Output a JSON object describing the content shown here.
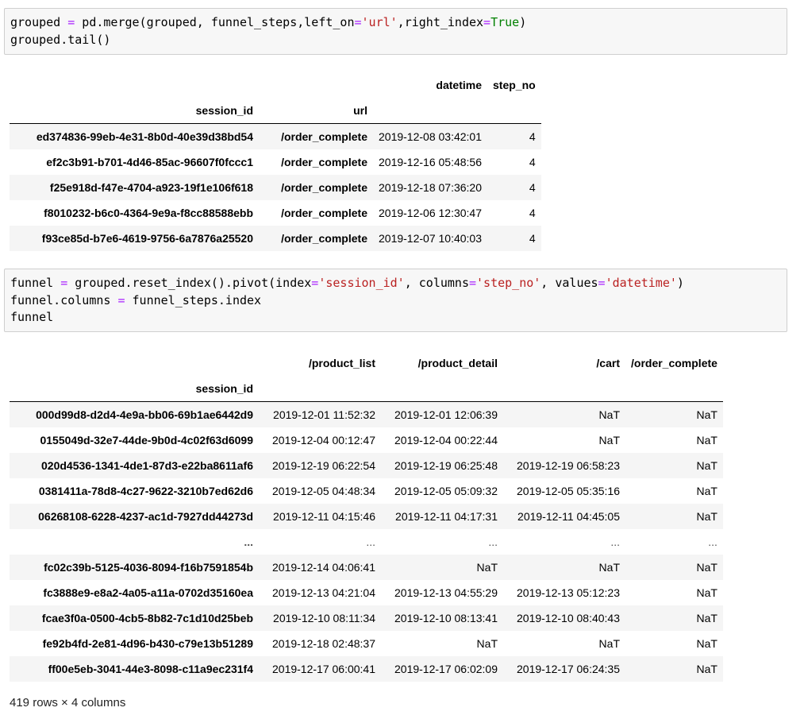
{
  "cell1": {
    "code": {
      "l1_a": "grouped ",
      "l1_b": "=",
      "l1_c": " pd.merge(grouped, funnel_steps,left_on",
      "l1_d": "=",
      "l1_e": "'url'",
      "l1_f": ",right_index",
      "l1_g": "=",
      "l1_h": "True",
      "l1_i": ")",
      "l2": "grouped.tail()"
    }
  },
  "table1": {
    "col_header_datetime": "datetime",
    "col_header_step_no": "step_no",
    "index_name": "session_id",
    "index_name2": "url",
    "rows": [
      {
        "session_id": "ed374836-99eb-4e31-8b0d-40e39d38bd54",
        "url": "/order_complete",
        "datetime": "2019-12-08 03:42:01",
        "step_no": "4"
      },
      {
        "session_id": "ef2c3b91-b701-4d46-85ac-96607f0fccc1",
        "url": "/order_complete",
        "datetime": "2019-12-16 05:48:56",
        "step_no": "4"
      },
      {
        "session_id": "f25e918d-f47e-4704-a923-19f1e106f618",
        "url": "/order_complete",
        "datetime": "2019-12-18 07:36:20",
        "step_no": "4"
      },
      {
        "session_id": "f8010232-b6c0-4364-9e9a-f8cc88588ebb",
        "url": "/order_complete",
        "datetime": "2019-12-06 12:30:47",
        "step_no": "4"
      },
      {
        "session_id": "f93ce85d-b7e6-4619-9756-6a7876a25520",
        "url": "/order_complete",
        "datetime": "2019-12-07 10:40:03",
        "step_no": "4"
      }
    ]
  },
  "cell2": {
    "code": {
      "l1_a": "funnel ",
      "l1_b": "=",
      "l1_c": " grouped.reset_index().pivot(index",
      "l1_d": "=",
      "l1_e": "'session_id'",
      "l1_f": ", columns",
      "l1_g": "=",
      "l1_h": "'step_no'",
      "l1_i": ", values",
      "l1_j": "=",
      "l1_k": "'datetime'",
      "l1_l": ")",
      "l2_a": "funnel.columns ",
      "l2_b": "=",
      "l2_c": " funnel_steps.index",
      "l3": "funnel"
    }
  },
  "table2": {
    "columns": [
      "/product_list",
      "/product_detail",
      "/cart",
      "/order_complete"
    ],
    "index_name": "session_id",
    "rows": [
      [
        "000d99d8-d2d4-4e9a-bb06-69b1ae6442d9",
        "2019-12-01 11:52:32",
        "2019-12-01 12:06:39",
        "NaT",
        "NaT"
      ],
      [
        "0155049d-32e7-44de-9b0d-4c02f63d6099",
        "2019-12-04 00:12:47",
        "2019-12-04 00:22:44",
        "NaT",
        "NaT"
      ],
      [
        "020d4536-1341-4de1-87d3-e22ba8611af6",
        "2019-12-19 06:22:54",
        "2019-12-19 06:25:48",
        "2019-12-19 06:58:23",
        "NaT"
      ],
      [
        "0381411a-78d8-4c27-9622-3210b7ed62d6",
        "2019-12-05 04:48:34",
        "2019-12-05 05:09:32",
        "2019-12-05 05:35:16",
        "NaT"
      ],
      [
        "06268108-6228-4237-ac1d-7927dd44273d",
        "2019-12-11 04:15:46",
        "2019-12-11 04:17:31",
        "2019-12-11 04:45:05",
        "NaT"
      ],
      [
        "...",
        "...",
        "...",
        "...",
        "..."
      ],
      [
        "fc02c39b-5125-4036-8094-f16b7591854b",
        "2019-12-14 04:06:41",
        "NaT",
        "NaT",
        "NaT"
      ],
      [
        "fc3888e9-e8a2-4a05-a11a-0702d35160ea",
        "2019-12-13 04:21:04",
        "2019-12-13 04:55:29",
        "2019-12-13 05:12:23",
        "NaT"
      ],
      [
        "fcae3f0a-0500-4cb5-8b82-7c1d10d25beb",
        "2019-12-10 08:11:34",
        "2019-12-10 08:13:41",
        "2019-12-10 08:40:43",
        "NaT"
      ],
      [
        "fe92b4fd-2e81-4d96-b430-c79e13b51289",
        "2019-12-18 02:48:37",
        "NaT",
        "NaT",
        "NaT"
      ],
      [
        "ff00e5eb-3041-44e3-8098-c11a9ec231f4",
        "2019-12-17 06:00:41",
        "2019-12-17 06:02:09",
        "2019-12-17 06:24:35",
        "NaT"
      ]
    ],
    "rows_info": "419 rows × 4 columns"
  }
}
